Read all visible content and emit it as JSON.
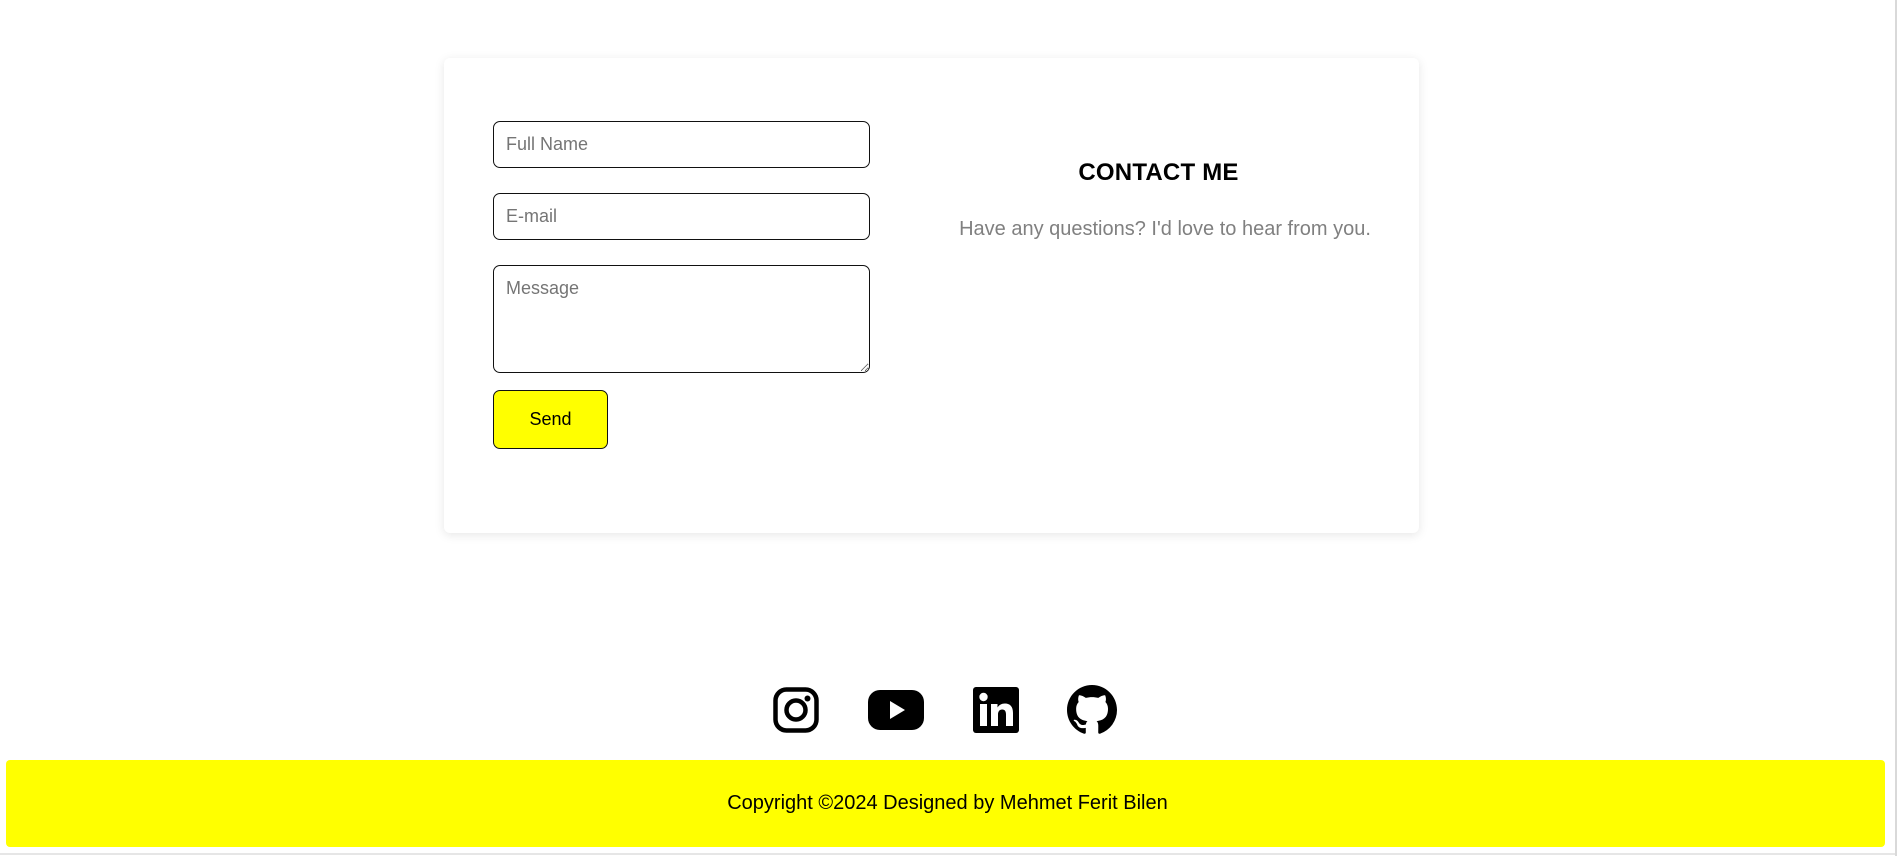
{
  "form": {
    "name_placeholder": "Full Name",
    "name_value": "",
    "email_placeholder": "E-mail",
    "email_value": "",
    "message_placeholder": "Message",
    "message_value": "",
    "send_label": "Send"
  },
  "contact": {
    "title": "CONTACT ME",
    "subtitle": "Have any questions? I'd love to hear from you."
  },
  "socials": [
    {
      "icon": "instagram-icon"
    },
    {
      "icon": "youtube-icon"
    },
    {
      "icon": "linkedin-icon"
    },
    {
      "icon": "github-icon"
    }
  ],
  "footer": {
    "copyright": "Copyright ©2024 Designed by Mehmet Ferit Bilen"
  },
  "colors": {
    "accent": "#ffff00",
    "text": "#000000",
    "muted": "#808080",
    "border": "#111111"
  }
}
